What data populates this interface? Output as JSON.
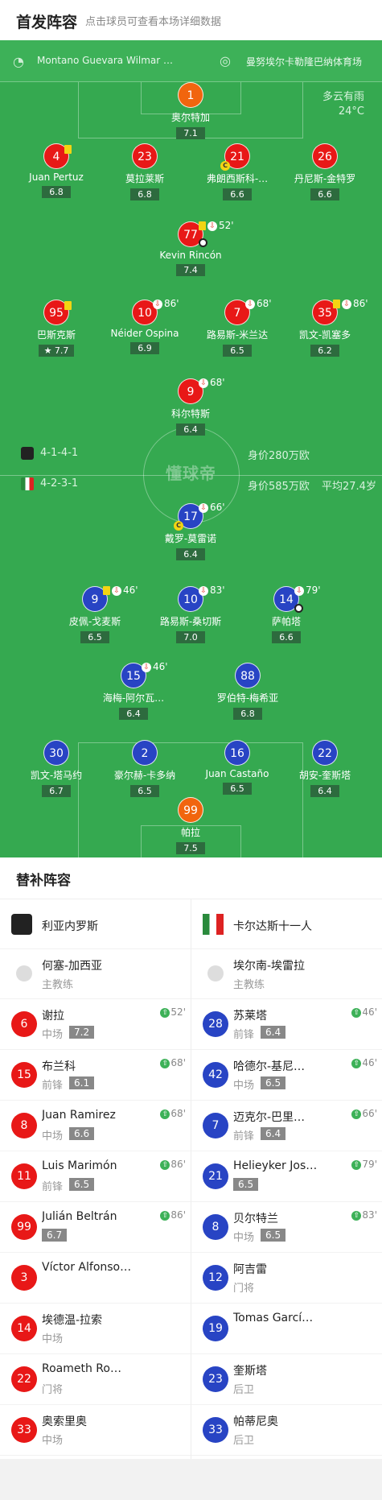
{
  "header": {
    "title": "首发阵容",
    "subtitle": "点击球员可查看本场详细数据"
  },
  "match": {
    "referee": "Montano Guevara Wilmar …",
    "stadium": "曼努埃尔卡勒隆巴纳体育场",
    "weather": "多云有雨",
    "temperature": "24°C",
    "watermark": "懂球帝"
  },
  "home": {
    "formation": "4-1-4-1",
    "value": "身价280万欧"
  },
  "away": {
    "formation": "4-2-3-1",
    "value": "身价585万欧",
    "age": "平均27.4岁"
  },
  "home_players": [
    {
      "num": "1",
      "name": "奥尔特加",
      "rating": "7.1",
      "events": ""
    },
    {
      "num": "4",
      "name": "Juan Pertuz",
      "rating": "6.8",
      "events": ""
    },
    {
      "num": "23",
      "name": "莫拉莱斯",
      "rating": "6.8",
      "events": ""
    },
    {
      "num": "21",
      "name": "弗朗西斯科-…",
      "rating": "6.6",
      "events": ""
    },
    {
      "num": "26",
      "name": "丹尼斯-金特罗",
      "rating": "6.6",
      "events": ""
    },
    {
      "num": "77",
      "name": "Kevin Rincón",
      "rating": "7.4",
      "events": "52'"
    },
    {
      "num": "95",
      "name": "巴斯克斯",
      "rating": "7.7",
      "events": ""
    },
    {
      "num": "10",
      "name": "Néider Ospina",
      "rating": "6.9",
      "events": "86'"
    },
    {
      "num": "7",
      "name": "路易斯-米兰达",
      "rating": "6.5",
      "events": "68'"
    },
    {
      "num": "35",
      "name": "凯文-凯塞多",
      "rating": "6.2",
      "events": "86'"
    },
    {
      "num": "9",
      "name": "科尔特斯",
      "rating": "6.4",
      "events": "68'"
    }
  ],
  "away_players": [
    {
      "num": "17",
      "name": "戴罗-莫雷诺",
      "rating": "6.4",
      "events": "66'"
    },
    {
      "num": "9",
      "name": "皮佩-戈麦斯",
      "rating": "6.5",
      "events": "46'"
    },
    {
      "num": "10",
      "name": "路易斯-桑切斯",
      "rating": "7.0",
      "events": "83'"
    },
    {
      "num": "14",
      "name": "萨帕塔",
      "rating": "6.6",
      "events": "79'"
    },
    {
      "num": "15",
      "name": "海梅-阿尔瓦…",
      "rating": "6.4",
      "events": "46'"
    },
    {
      "num": "88",
      "name": "罗伯特-梅希亚",
      "rating": "6.8",
      "events": ""
    },
    {
      "num": "30",
      "name": "凯文-塔马约",
      "rating": "6.7",
      "events": ""
    },
    {
      "num": "2",
      "name": "豪尔赫-卡多纳",
      "rating": "6.5",
      "events": ""
    },
    {
      "num": "16",
      "name": "Juan Castaño",
      "rating": "6.5",
      "events": ""
    },
    {
      "num": "22",
      "name": "胡安-奎斯塔",
      "rating": "6.4",
      "events": ""
    },
    {
      "num": "99",
      "name": "帕拉",
      "rating": "7.5",
      "events": ""
    }
  ],
  "bench": {
    "title": "替补阵容",
    "home_team": "利亚内罗斯",
    "away_team": "卡尔达斯十一人",
    "home_coach": {
      "name": "何塞-加西亚",
      "role": "主教练"
    },
    "away_coach": {
      "name": "埃尔南-埃雷拉",
      "role": "主教练"
    },
    "home": [
      {
        "num": "6",
        "name": "谢拉",
        "pos": "中场",
        "rating": "7.2",
        "time": "52'"
      },
      {
        "num": "15",
        "name": "布兰科",
        "pos": "前锋",
        "rating": "6.1",
        "time": "68'"
      },
      {
        "num": "8",
        "name": "Juan Ramirez",
        "pos": "中场",
        "rating": "6.6",
        "time": "68'"
      },
      {
        "num": "11",
        "name": "Luis Marimón",
        "pos": "前锋",
        "rating": "6.5",
        "time": "86'"
      },
      {
        "num": "99",
        "name": "Julián Beltrán",
        "pos": "",
        "rating": "6.7",
        "time": "86'"
      },
      {
        "num": "3",
        "name": "Víctor Alfonso…",
        "pos": "",
        "rating": "",
        "time": ""
      },
      {
        "num": "14",
        "name": "埃德温-拉索",
        "pos": "中场",
        "rating": "",
        "time": ""
      },
      {
        "num": "22",
        "name": "Roameth Ro…",
        "pos": "门将",
        "rating": "",
        "time": ""
      },
      {
        "num": "33",
        "name": "奥索里奥",
        "pos": "中场",
        "rating": "",
        "time": ""
      }
    ],
    "away": [
      {
        "num": "28",
        "name": "苏莱塔",
        "pos": "前锋",
        "rating": "6.4",
        "time": "46'"
      },
      {
        "num": "42",
        "name": "哈德尔-基尼…",
        "pos": "中场",
        "rating": "6.5",
        "time": "46'"
      },
      {
        "num": "7",
        "name": "迈克尔-巴里…",
        "pos": "前锋",
        "rating": "6.4",
        "time": "66'"
      },
      {
        "num": "21",
        "name": "Helieyker Jos…",
        "pos": "",
        "rating": "6.5",
        "time": "79'"
      },
      {
        "num": "8",
        "name": "贝尔特兰",
        "pos": "中场",
        "rating": "6.5",
        "time": "83'"
      },
      {
        "num": "12",
        "name": "阿吉雷",
        "pos": "门将",
        "rating": "",
        "time": ""
      },
      {
        "num": "19",
        "name": "Tomas Garcí…",
        "pos": "",
        "rating": "",
        "time": ""
      },
      {
        "num": "23",
        "name": "奎斯塔",
        "pos": "后卫",
        "rating": "",
        "time": ""
      },
      {
        "num": "33",
        "name": "帕蒂尼奥",
        "pos": "后卫",
        "rating": "",
        "time": ""
      }
    ]
  },
  "colors": {
    "pitch": "#35a950",
    "home": "#e81817",
    "away": "#2844c4",
    "keeper": "#f1650e"
  }
}
